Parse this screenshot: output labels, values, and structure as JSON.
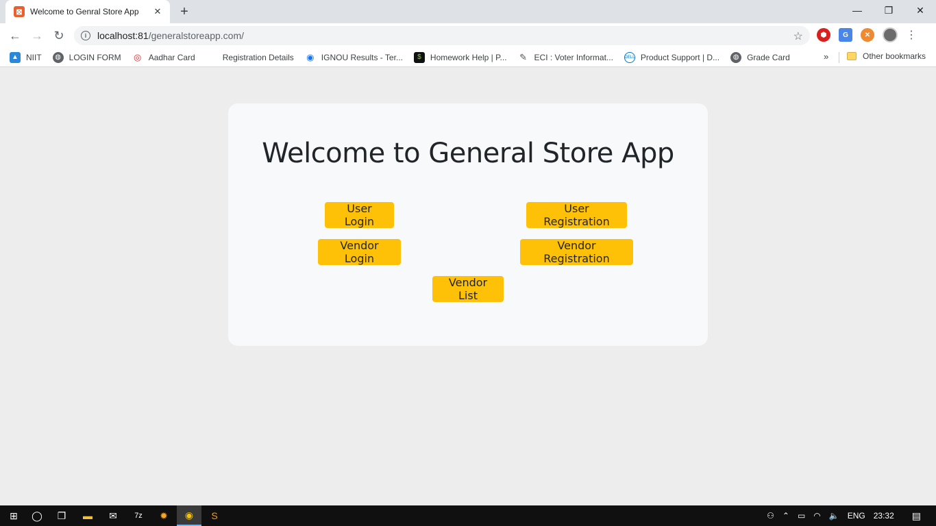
{
  "browser": {
    "tab_title": "Welcome to Genral Store App",
    "tab_favicon": "xampp-icon",
    "new_tab": "+",
    "url_host": "localhost:81",
    "url_path": "/generalstoreapp.com/",
    "window_controls": {
      "minimize": "—",
      "restore": "❐",
      "close": "✕"
    },
    "nav": {
      "back": "←",
      "forward": "→",
      "reload": "↻"
    }
  },
  "bookmarks": {
    "items": [
      {
        "label": "NIIT",
        "icon": "niit-icon",
        "color": "#2b88d8"
      },
      {
        "label": "LOGIN FORM",
        "icon": "globe-icon",
        "color": "#5f6368"
      },
      {
        "label": "Aadhar Card",
        "icon": "fingerprint-icon",
        "color": "#d32f2f"
      },
      {
        "label": "Registration Details",
        "icon": "",
        "color": ""
      },
      {
        "label": "IGNOU Results - Ter...",
        "icon": "ignou-icon",
        "color": "#1a73e8"
      },
      {
        "label": "Homework Help | P...",
        "icon": "homework-icon",
        "color": "#111111"
      },
      {
        "label": "ECI : Voter Informat...",
        "icon": "eci-icon",
        "color": "#555555"
      },
      {
        "label": "Product Support | D...",
        "icon": "dell-icon",
        "color": "#0076ce"
      },
      {
        "label": "Grade Card",
        "icon": "globe-icon",
        "color": "#5f6368"
      }
    ],
    "more": "»",
    "other": "Other bookmarks"
  },
  "page": {
    "title": "Welcome to General Store App",
    "buttons": {
      "user_login": "User Login",
      "user_registration": "User Registration",
      "vendor_login": "Vendor Login",
      "vendor_registration": "Vendor Registration",
      "vendor_list": "Vendor List"
    },
    "colors": {
      "button": "#ffc107",
      "card": "#f8f9fa",
      "background": "#ededed"
    }
  },
  "taskbar": {
    "language": "ENG",
    "time": "23:32"
  }
}
